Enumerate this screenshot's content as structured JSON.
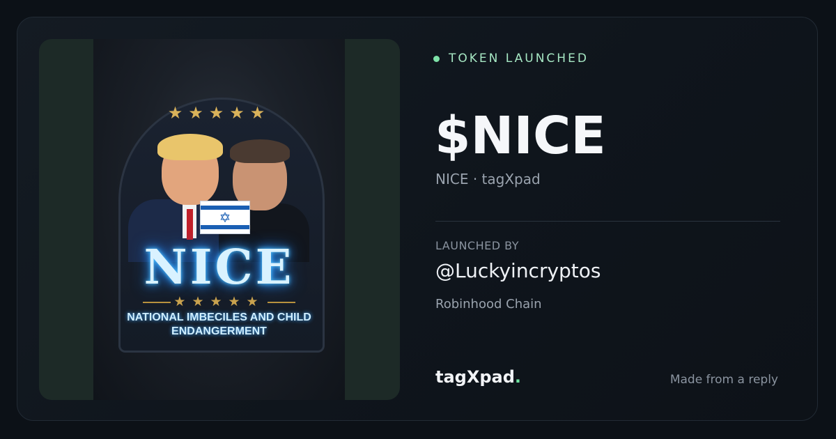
{
  "status": {
    "label": "TOKEN LAUNCHED",
    "dot_color": "#7ee2a8"
  },
  "token": {
    "ticker": "$NICE",
    "subtitle": "NICE · tagXpad"
  },
  "launch": {
    "label": "LAUNCHED BY",
    "handle": "@Luckyincryptos",
    "chain": "Robinhood Chain"
  },
  "footer": {
    "brand": "tagXpad",
    "brand_dot": ".",
    "note": "Made from a reply"
  },
  "image": {
    "patch_word": "NICE",
    "patch_motto": "NATIONAL IMBECILES AND CHILD ENDANGERMENT",
    "top_stars": "★★★★★",
    "mid_stars": "★★★★★"
  },
  "colors": {
    "background": "#0c1117",
    "accent_green": "#6fe3a0",
    "media_frame": "#1d2a27"
  }
}
